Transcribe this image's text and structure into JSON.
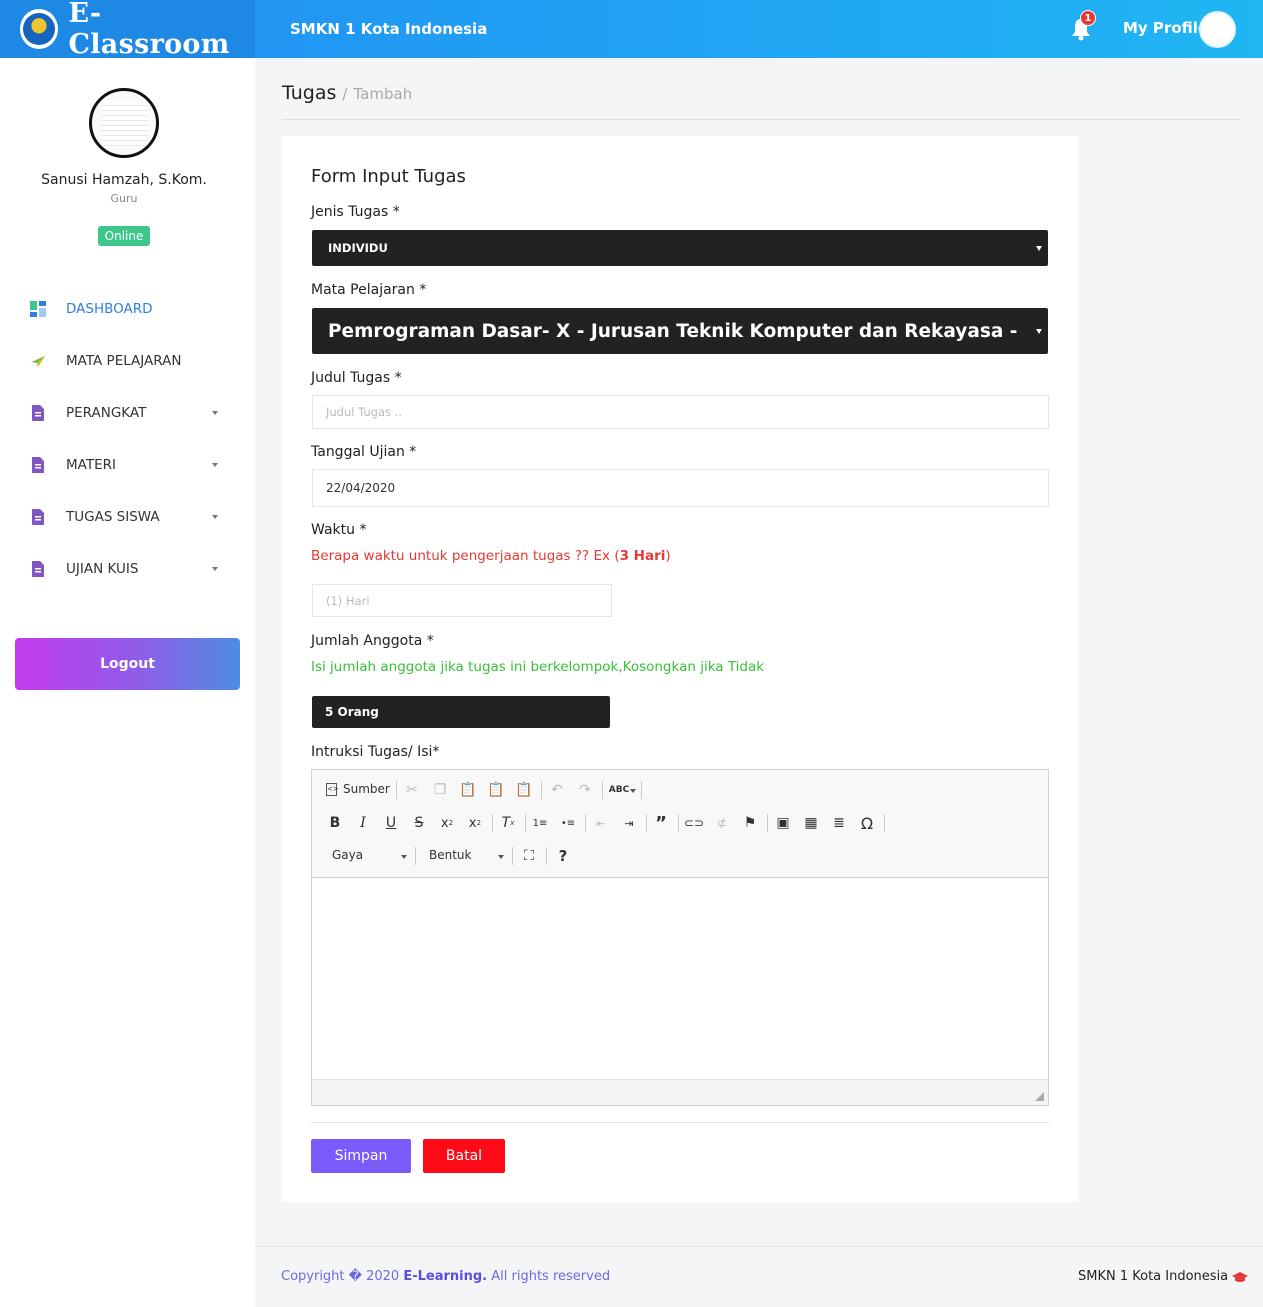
{
  "brand": {
    "title": "E-Classroom"
  },
  "header": {
    "school": "SMKN 1 Kota Indonesia",
    "notification_count": "1",
    "profile_label": "My Profile"
  },
  "sidebar": {
    "user_name": "Sanusi Hamzah, S.Kom.",
    "user_role": "Guru",
    "status": "Online",
    "items": [
      {
        "label": "DASHBOARD",
        "icon": "dashboard-icon",
        "active": true
      },
      {
        "label": "MATA PELAJARAN",
        "icon": "paper-plane-icon"
      },
      {
        "label": "PERANGKAT",
        "icon": "document-icon",
        "dropdown": true
      },
      {
        "label": "MATERI",
        "icon": "document-icon",
        "dropdown": true
      },
      {
        "label": "TUGAS SISWA",
        "icon": "document-icon",
        "dropdown": true
      },
      {
        "label": "UJIAN KUIS",
        "icon": "document-icon",
        "dropdown": true
      }
    ],
    "logout_label": "Logout"
  },
  "breadcrumb": {
    "title": "Tugas",
    "separator": "/",
    "sub": "Tambah"
  },
  "form": {
    "title": "Form Input Tugas",
    "jenis_label": "Jenis Tugas *",
    "jenis_value": "INDIVIDU",
    "mapel_label": "Mata Pelajaran *",
    "mapel_value": "Pemrograman Dasar- X - Jurusan Teknik Komputer dan Rekayasa - S",
    "judul_label": "Judul Tugas *",
    "judul_placeholder": "Judul Tugas ..",
    "tanggal_label": "Tanggal Ujian *",
    "tanggal_value": "22/04/2020",
    "waktu_label": "Waktu *",
    "waktu_hint": "Berapa waktu untuk pengerjaan tugas ?? Ex (",
    "waktu_hint_bold": "3 Hari",
    "waktu_hint_end": ")",
    "waktu_placeholder": "(1) Hari",
    "anggota_label": "Jumlah Anggota *",
    "anggota_hint": "Isi jumlah anggota jika tugas ini berkelompok,Kosongkan jika Tidak",
    "anggota_value": "5 Orang",
    "instruksi_label": "Intruksi Tugas/ Isi*",
    "save_label": "Simpan",
    "cancel_label": "Batal"
  },
  "editor": {
    "source_label": "Sumber",
    "style_label": "Gaya",
    "format_label": "Bentuk",
    "help_label": "?"
  },
  "footer": {
    "copyright_prefix": "Copyright � 2020 ",
    "brand": "E-Learning.",
    "rights": " All rights reserved",
    "right_text": "SMKN 1 Kota Indonesia"
  },
  "colors": {
    "primary": "#1e88e5",
    "online": "#3ec78b",
    "save": "#7a5af8",
    "cancel": "#ff0a17",
    "hint_red": "#e53935",
    "hint_green": "#3bbf3b"
  }
}
